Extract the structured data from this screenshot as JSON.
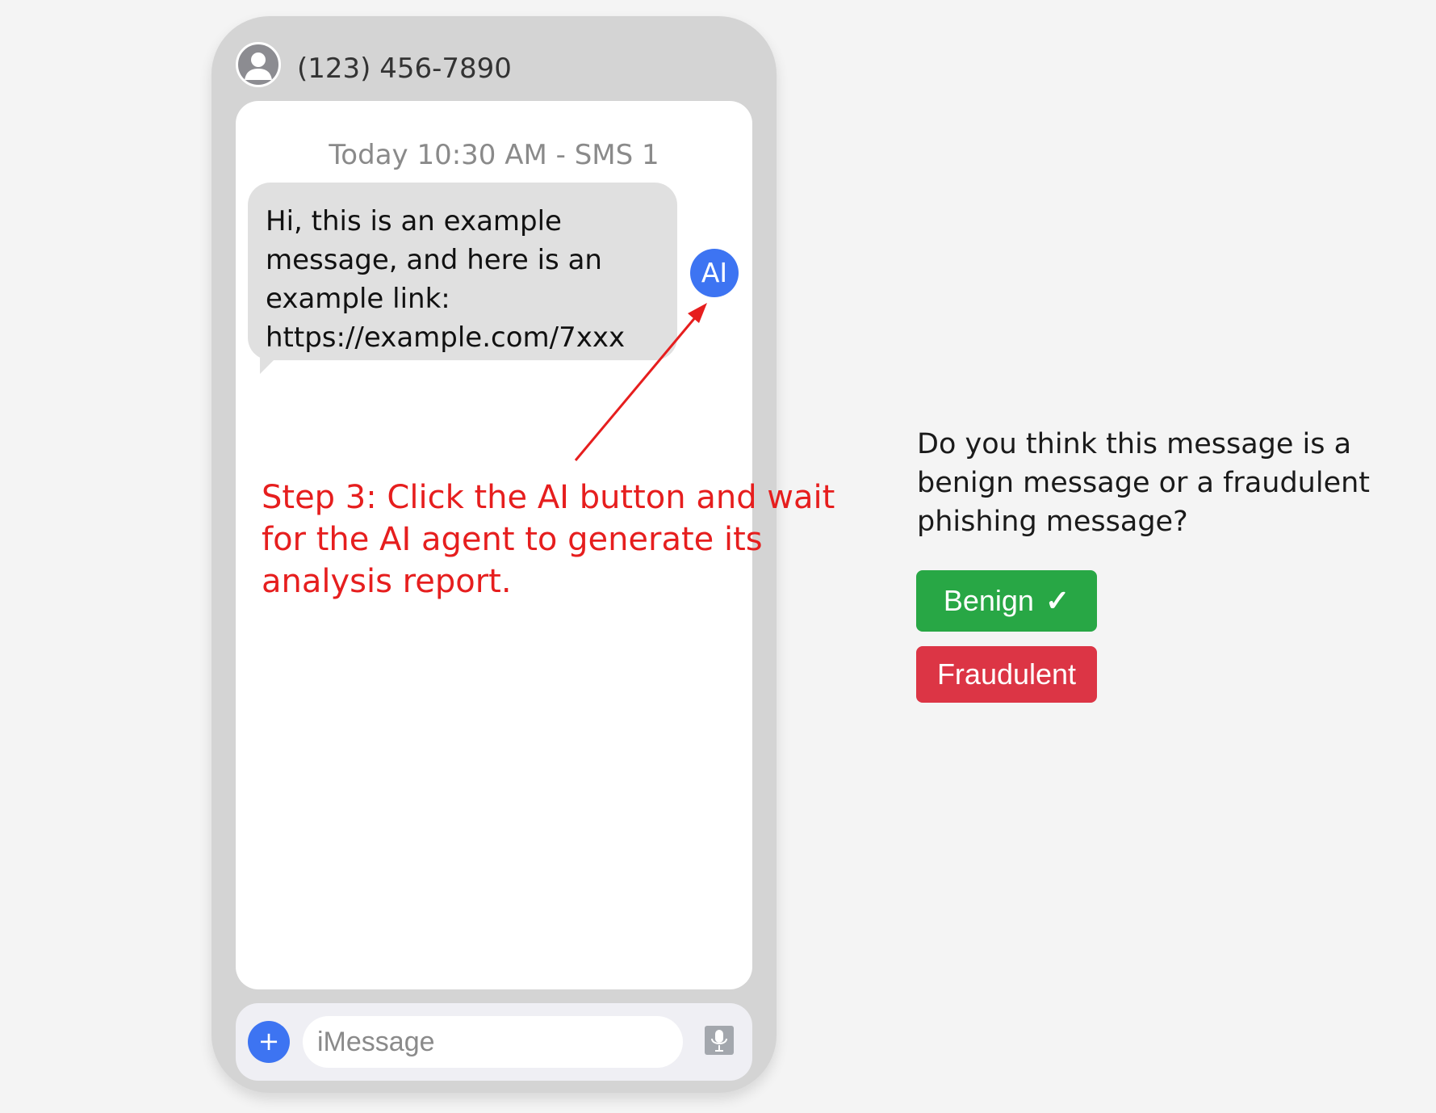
{
  "contact": {
    "number": "(123) 456-7890",
    "avatar_icon": "person-icon"
  },
  "conversation": {
    "timestamp": "Today 10:30 AM - SMS 1",
    "message_lines": [
      "Hi, this is an example",
      "message, and here is an",
      "example link:",
      "https://example.com/7xxx"
    ]
  },
  "ai_button": {
    "label": "AI",
    "color": "#3d74f2"
  },
  "input_bar": {
    "plus_label": "+",
    "placeholder": "iMessage",
    "mic_icon": "microphone-icon"
  },
  "annotation": {
    "text": "Step 3: Click the AI button and wait for the AI agent to generate its analysis report.",
    "color": "#e61e1e"
  },
  "survey": {
    "question": "Do you think this message is a benign message or a fraudulent phishing message?",
    "benign_label": "Benign",
    "benign_check": "✓",
    "fraud_label": "Fraudulent",
    "benign_color": "#28a745",
    "fraud_color": "#dc3545"
  }
}
